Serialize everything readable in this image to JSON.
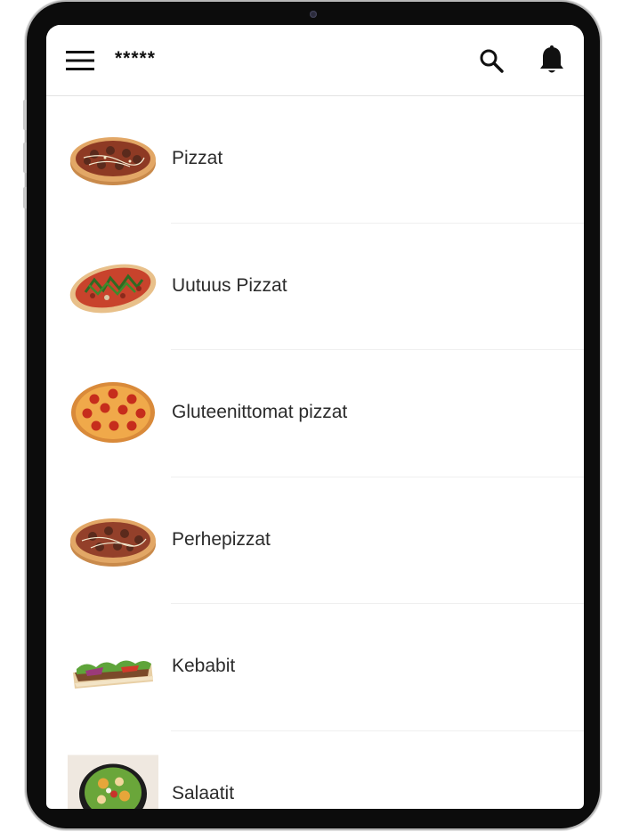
{
  "app_bar": {
    "title": "*****",
    "menu_icon": "hamburger-menu-icon",
    "search_icon": "search-icon",
    "notification_icon": "bell-icon"
  },
  "categories": [
    {
      "label": "Pizzat",
      "image": "pizza-image"
    },
    {
      "label": "Uutuus Pizzat",
      "image": "arugula-pizza-image"
    },
    {
      "label": "Gluteenittomat pizzat",
      "image": "pepperoni-pizza-image"
    },
    {
      "label": "Perhepizzat",
      "image": "family-pizza-image"
    },
    {
      "label": "Kebabit",
      "image": "kebab-image"
    },
    {
      "label": "Salaatit",
      "image": "salad-image"
    }
  ]
}
